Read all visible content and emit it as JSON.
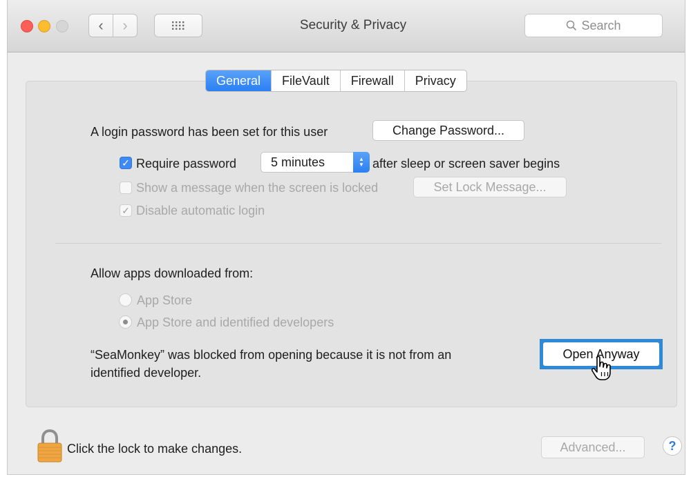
{
  "window": {
    "title": "Security & Privacy"
  },
  "toolbar": {
    "back_glyph": "‹",
    "forward_glyph": "›",
    "search_placeholder": "Search"
  },
  "tabs": [
    {
      "label": "General",
      "active": true
    },
    {
      "label": "FileVault",
      "active": false
    },
    {
      "label": "Firewall",
      "active": false
    },
    {
      "label": "Privacy",
      "active": false
    }
  ],
  "general": {
    "login_text": "A login password has been set for this user",
    "change_password_button": "Change Password...",
    "require_password": {
      "label": "Require password",
      "checked": true
    },
    "require_password_delay": "5 minutes",
    "require_password_suffix": "after sleep or screen saver begins",
    "show_message": {
      "label": "Show a message when the screen is locked",
      "checked": false,
      "enabled": false
    },
    "set_lock_message_button": "Set Lock Message...",
    "disable_auto_login": {
      "label": "Disable automatic login",
      "checked": true,
      "enabled": false
    },
    "allow_apps_label": "Allow apps downloaded from:",
    "radio_app_store": {
      "label": "App Store",
      "selected": false,
      "enabled": false
    },
    "radio_identified": {
      "label": "App Store and identified developers",
      "selected": true,
      "enabled": false
    },
    "blocked_line1": "“SeaMonkey” was blocked from opening because it is not from an",
    "blocked_line2": "identified developer.",
    "open_anyway_button": "Open Anyway"
  },
  "footer": {
    "lock_text": "Click the lock to make changes.",
    "advanced_button": "Advanced...",
    "help_glyph": "?"
  },
  "colors": {
    "accent": "#2a7ff3",
    "highlight_border": "#2e8ad7",
    "lock_gold": "#f0a640",
    "close_red": "#fc5f57",
    "minimize_yellow": "#fdbc2e"
  }
}
